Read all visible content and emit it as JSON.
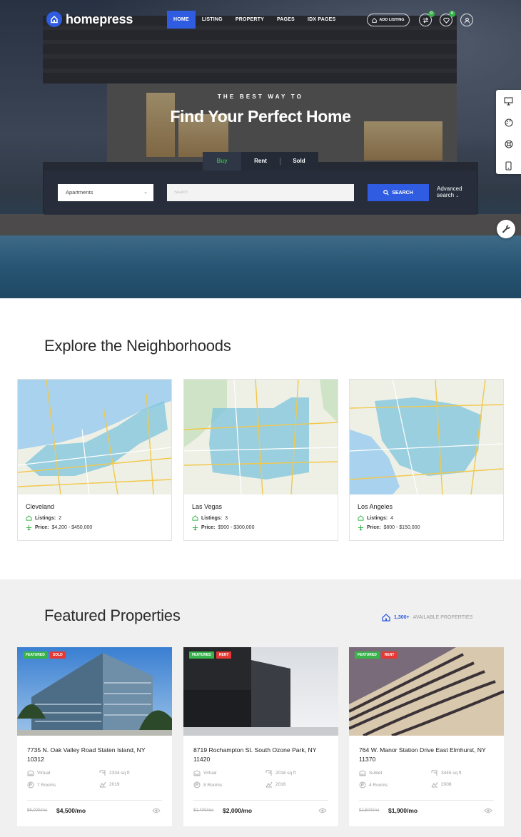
{
  "brand": {
    "name": "homepress",
    "accent": "#2f5ce0",
    "green": "#37b34a",
    "red": "#e53935"
  },
  "nav": {
    "menu": [
      "HOME",
      "LISTING",
      "PROPERTY",
      "PAGES",
      "IDX PAGES"
    ],
    "add_listing": "ADD LISTING",
    "compare_badge": "0",
    "favorites_badge": "0"
  },
  "hero": {
    "tagline": "THE BEST WAY TO",
    "headline": "Find Your Perfect Home",
    "tabs": [
      "Buy",
      "Rent",
      "Sold"
    ],
    "select_value": "Apartments",
    "search_placeholder": "Search",
    "search_button": "SEARCH",
    "advanced": "Advanced",
    "advanced2": "search"
  },
  "neighborhoods": {
    "title": "Explore the Neighborhoods",
    "listings_label": "Listings:",
    "price_label": "Price:",
    "cards": [
      {
        "name": "Cleveland",
        "listings": "2",
        "price": "$4,200 - $450,000"
      },
      {
        "name": "Las Vegas",
        "listings": "3",
        "price": "$900 - $300,000"
      },
      {
        "name": "Los Angeles",
        "listings": "4",
        "price": "$800 - $150,000"
      }
    ]
  },
  "featured": {
    "title": "Featured Properties",
    "available_count": "1,300+",
    "available_label": "AVAILABLE PROPERTIES",
    "properties": [
      {
        "badges": [
          "FEATURED",
          "SOLD"
        ],
        "title": "7735 N. Oak Valley Road Staten Island, NY 10312",
        "type": "Virtual",
        "area": "2334 sq ft",
        "rooms": "7 Rooms",
        "year": "2019",
        "old_price": "$6,000/mo",
        "price": "$4,500/mo"
      },
      {
        "badges": [
          "FEATURED",
          "RENT"
        ],
        "title": "8719 Rochampton St. South Ozone Park, NY 11420",
        "type": "Virtual",
        "area": "2016 sq ft",
        "rooms": "8 Rooms",
        "year": "2016",
        "old_price": "$2,400/mo",
        "price": "$2,000/mo"
      },
      {
        "badges": [
          "FEATURED",
          "RENT"
        ],
        "title": "764 W. Manor Station Drive East Elmhurst, NY 11370",
        "type": "Sublet",
        "area": "3445 sq ft",
        "rooms": "4 Rooms",
        "year": "2008",
        "old_price": "$2,500/mo",
        "price": "$1,900/mo"
      }
    ]
  }
}
